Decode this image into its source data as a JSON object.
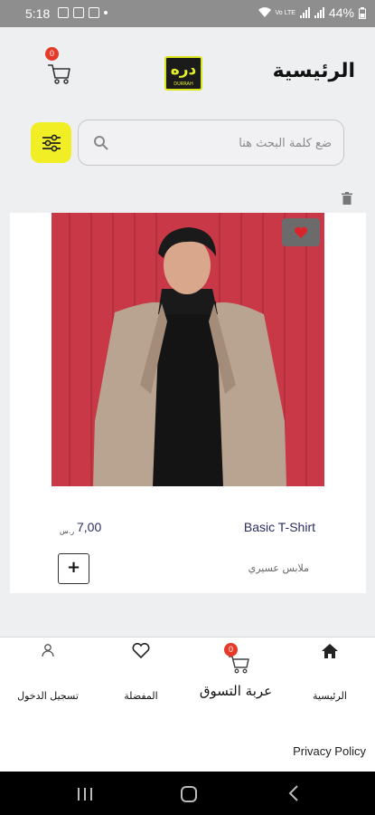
{
  "status_bar": {
    "time": "5:18",
    "battery": "44%",
    "network": "Vo LTE"
  },
  "header": {
    "title": "الرئيسية",
    "cart_count": "0",
    "logo_text": "دره",
    "logo_subtext": "DURRAH"
  },
  "search": {
    "placeholder": "ضع كلمة البحث هنا"
  },
  "product": {
    "name": "Basic T-Shirt",
    "price": "7,00",
    "currency": "ر.س",
    "category": "ملابس عسيري",
    "add_label": "+"
  },
  "bottom_nav": {
    "home": "الرئيسية",
    "cart": "عربة التسوق",
    "cart_count": "0",
    "favorites": "المفضلة",
    "login": "تسجيل الدخول",
    "privacy": "Privacy Policy"
  },
  "colors": {
    "accent": "#f1ee25",
    "badge": "#e63a28",
    "price_text": "#2a2d62"
  }
}
